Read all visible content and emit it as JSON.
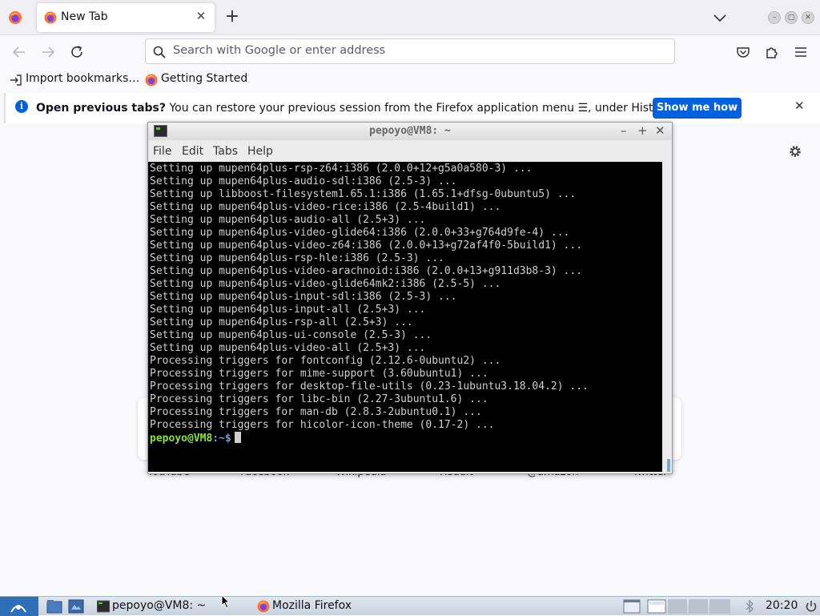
{
  "browser": {
    "tab": {
      "title": "New Tab",
      "close_glyph": "✕"
    },
    "newtab_glyph": "+",
    "urlbar": {
      "placeholder": "Search with Google or enter address"
    },
    "bookmarks": [
      {
        "label": "Import bookmarks…",
        "icon": "import-icon"
      },
      {
        "label": "Getting Started",
        "icon": "firefox-icon"
      }
    ],
    "notification": {
      "bold": "Open previous tabs?",
      "text": " You can restore your previous session from the Firefox application menu ☰, under History.",
      "button": "Show me how",
      "close_glyph": "✕"
    },
    "shortcuts": [
      "YouTube",
      "Facebook",
      "Wikipedia",
      "Reddit",
      "@amazon",
      "Twitter"
    ]
  },
  "terminal": {
    "title": "pepoyo@VM8: ~",
    "menu": [
      "File",
      "Edit",
      "Tabs",
      "Help"
    ],
    "lines": [
      "Setting up mupen64plus-rsp-z64:i386 (2.0.0+12+g5a0a580-3) ...",
      "Setting up mupen64plus-audio-sdl:i386 (2.5-3) ...",
      "Setting up libboost-filesystem1.65.1:i386 (1.65.1+dfsg-0ubuntu5) ...",
      "Setting up mupen64plus-video-rice:i386 (2.5-4build1) ...",
      "Setting up mupen64plus-audio-all (2.5+3) ...",
      "Setting up mupen64plus-video-glide64:i386 (2.0.0+33+g764d9fe-4) ...",
      "Setting up mupen64plus-video-z64:i386 (2.0.0+13+g72af4f0-5build1) ...",
      "Setting up mupen64plus-rsp-hle:i386 (2.5-3) ...",
      "Setting up mupen64plus-video-arachnoid:i386 (2.0.0+13+g911d3b8-3) ...",
      "Setting up mupen64plus-video-glide64mk2:i386 (2.5-5) ...",
      "Setting up mupen64plus-input-sdl:i386 (2.5-3) ...",
      "Setting up mupen64plus-input-all (2.5+3) ...",
      "Setting up mupen64plus-rsp-all (2.5+3) ...",
      "Setting up mupen64plus-ui-console (2.5-3) ...",
      "Setting up mupen64plus-video-all (2.5+3) ...",
      "Processing triggers for fontconfig (2.12.6-0ubuntu2) ...",
      "Processing triggers for mime-support (3.60ubuntu1) ...",
      "Processing triggers for desktop-file-utils (0.23-1ubuntu3.18.04.2) ...",
      "Processing triggers for libc-bin (2.27-3ubuntu1.6) ...",
      "Processing triggers for man-db (2.8.3-2ubuntu0.1) ...",
      "Processing triggers for hicolor-icon-theme (0.17-2) ..."
    ],
    "prompt_user": "pepoyo@VM8",
    "prompt_path": ":~$"
  },
  "taskbar": {
    "tasks": [
      "pepoyo@VM8: ~",
      "Mozilla Firefox"
    ],
    "clock": "20:20"
  }
}
